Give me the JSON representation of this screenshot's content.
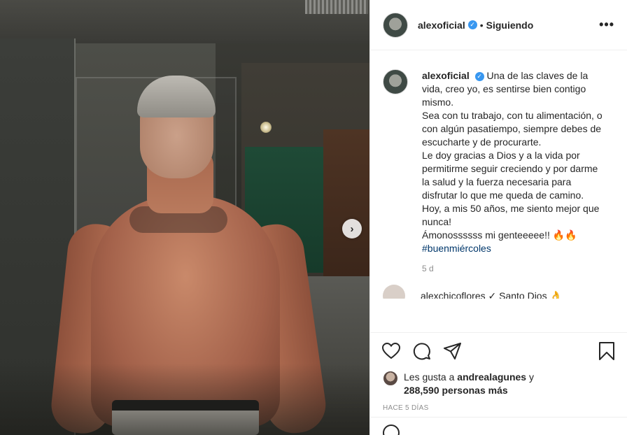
{
  "post": {
    "username": "alexoficial",
    "verified_symbol": "✓",
    "separator": "•",
    "follow_status": "Siguiendo",
    "more_label": "•••",
    "carousel_next": "›"
  },
  "caption": {
    "username": "alexoficial",
    "text": "Una de las claves de la vida, creo yo, es sentirse bien contigo mismo.\nSea con tu trabajo, con tu alimentación, o con algún pasatiempo, siempre debes de escucharte y de procurarte.\nLe doy gracias a Dios y a la vida por permitirme seguir creciendo y por darme la salud y la fuerza necesaria para disfrutar lo que me queda de camino.\nHoy, a mis 50 años, me siento mejor que nunca!\nÁmonossssss mi genteeeee!! 🔥🔥",
    "hashtag": "#buenmiércoles",
    "time": "5 d"
  },
  "comment_peek": {
    "text": "alexchicoflores ✓ Santo Dios 👌"
  },
  "actions": {
    "like": "heart-icon",
    "comment": "comment-icon",
    "share": "share-icon",
    "save": "bookmark-icon"
  },
  "likes": {
    "prefix": "Les gusta a ",
    "user": "andrealagunes",
    "suffix": " y",
    "count": "288,590 personas más"
  },
  "date_label": "HACE 5 DÍAS",
  "colors": {
    "verified": "#3897f0",
    "hashtag": "#00376b",
    "secondary_text": "#8e8e8e"
  }
}
